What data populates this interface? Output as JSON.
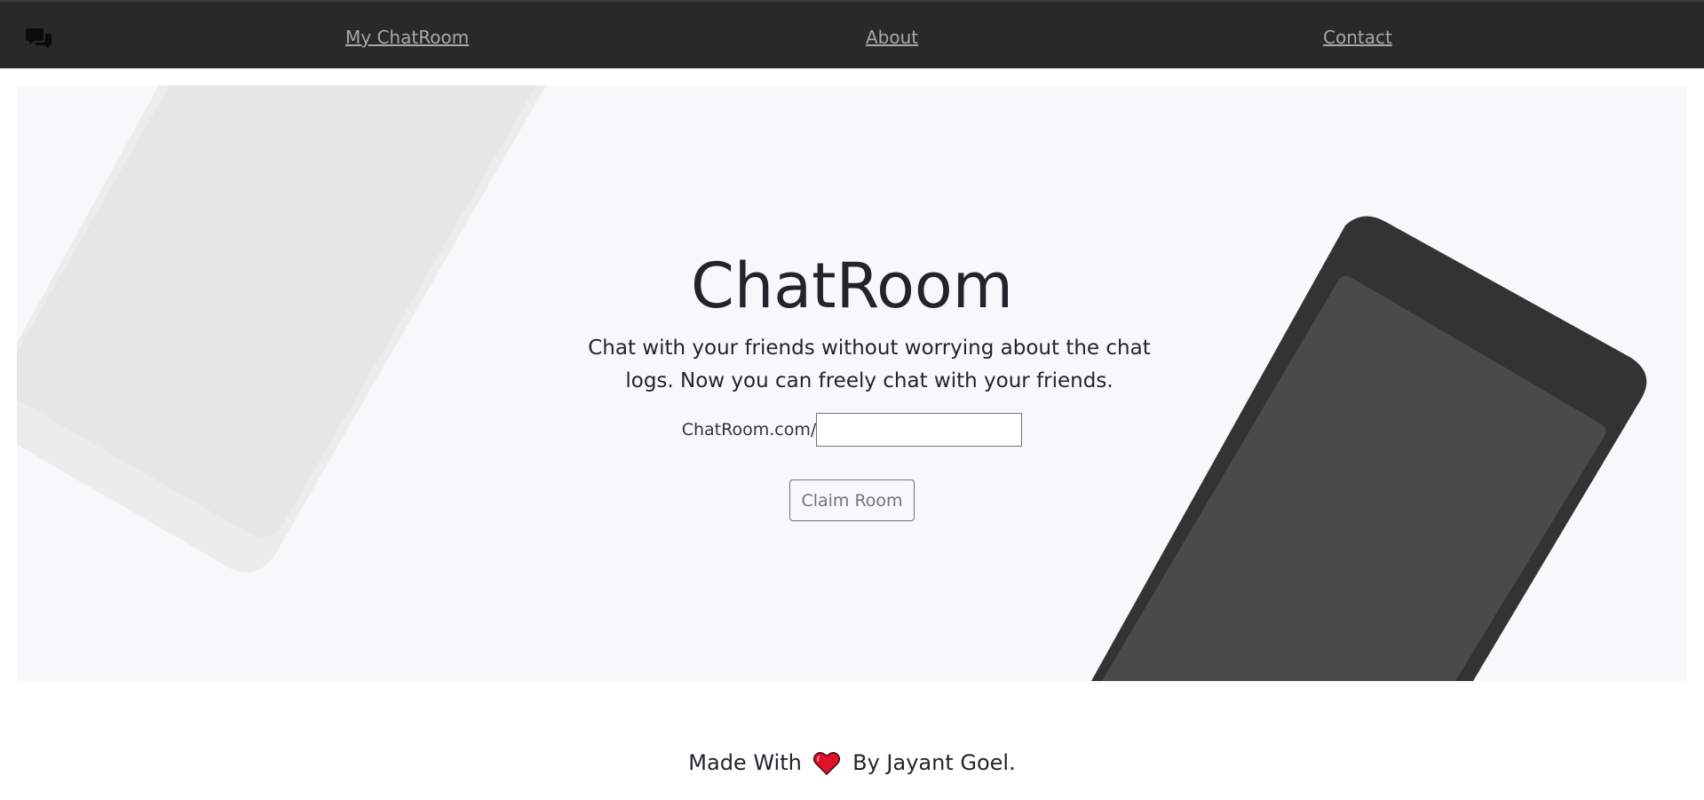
{
  "nav": {
    "brand_icon": "chat-bubbles-icon",
    "links": [
      "My ChatRoom",
      "About",
      "Contact"
    ]
  },
  "hero": {
    "title": "ChatRoom",
    "subtitle": "Chat with your friends without worrying about the chat logs. Now you can freely chat with your friends.",
    "room_prefix": "ChatRoom.com/",
    "room_input_value": "",
    "claim_label": "Claim Room"
  },
  "footer": {
    "before": "Made With",
    "heart_icon": "heart-icon",
    "after": "By Jayant Goel."
  },
  "colors": {
    "navbar": "#292929",
    "hero_bg": "#f7f8fa",
    "phone_dark": "#333333",
    "phone_screen": "#4a4a4a",
    "heart": "#e0112b"
  }
}
